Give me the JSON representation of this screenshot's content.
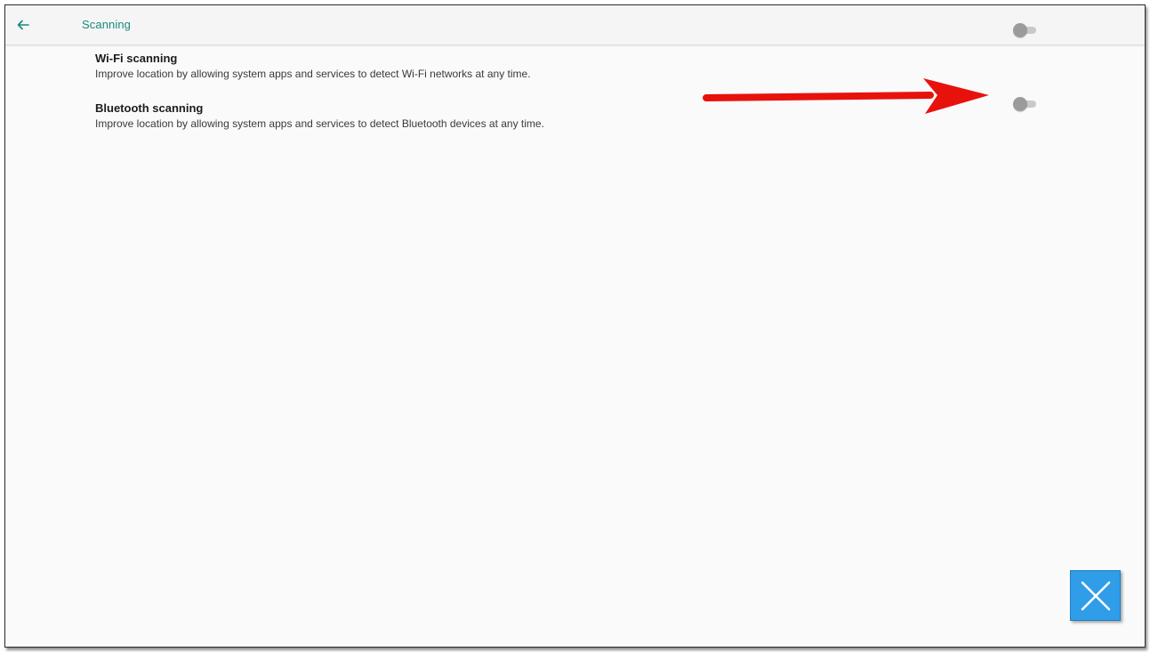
{
  "header": {
    "title": "Scanning",
    "back_icon": "arrow-left-icon"
  },
  "settings": [
    {
      "title": "Wi-Fi scanning",
      "summary": "Improve location by allowing system apps and services to detect Wi-Fi networks at any time.",
      "enabled": false
    },
    {
      "title": "Bluetooth scanning",
      "summary": "Improve location by allowing system apps and services to detect Bluetooth devices at any time.",
      "enabled": false
    }
  ],
  "annotation": {
    "icon": "red-arrow-icon",
    "color": "#e8120c"
  },
  "close_button": {
    "icon": "close-icon",
    "color": "#2f9de8"
  },
  "colors": {
    "accent": "#1a8a80",
    "background": "#fafafa",
    "switch_thumb_off": "#9b9b9b",
    "switch_track_off": "#c9c9c9"
  }
}
